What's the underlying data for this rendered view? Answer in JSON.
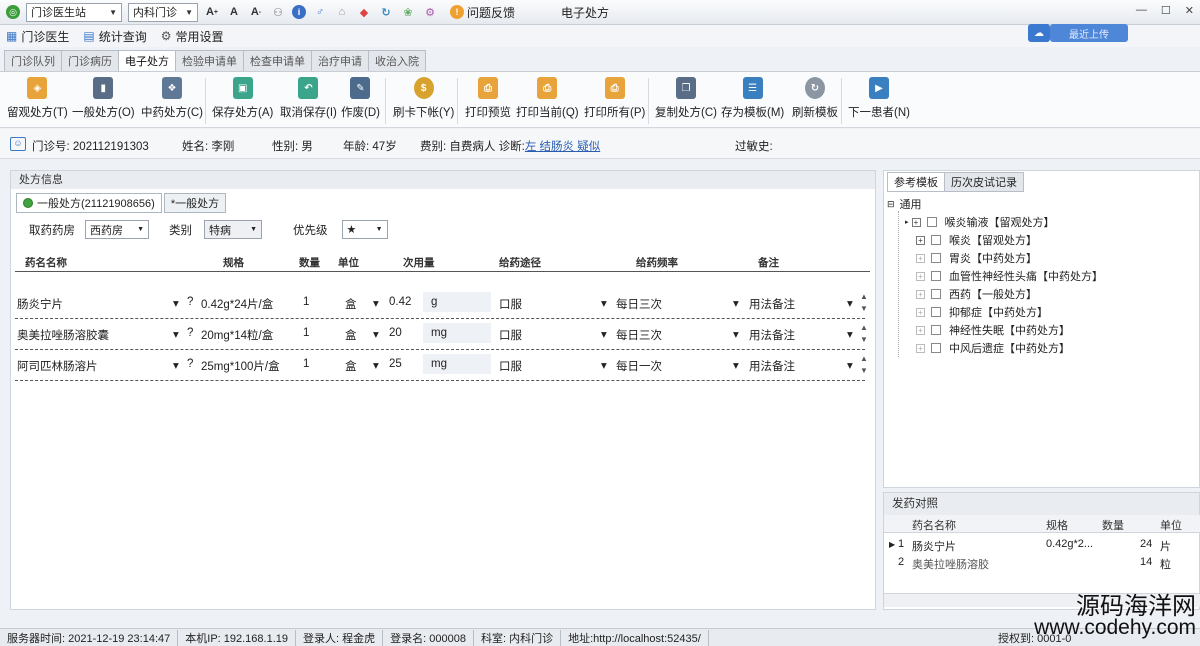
{
  "topbar": {
    "station": "门诊医生站",
    "dept": "内科门诊",
    "feedback": "问题反馈",
    "window_title": "电子处方"
  },
  "menu": {
    "items": [
      "门诊医生",
      "统计查询",
      "常用设置"
    ],
    "upload_label": "最近上传"
  },
  "tabs": [
    "门诊队列",
    "门诊病历",
    "电子处方",
    "检验申请单",
    "检查申请单",
    "治疗申请",
    "收治入院"
  ],
  "active_tab": "电子处方",
  "ribbon": {
    "buttons": [
      "留观处方(T)",
      "一般处方(O)",
      "中药处方(C)",
      "保存处方(A)",
      "取消保存(I)",
      "作废(D)",
      "刷卡下帐(Y)",
      "打印预览",
      "打印当前(Q)",
      "打印所有(P)",
      "复制处方(C)",
      "存为模板(M)",
      "刷新模板",
      "下一患者(N)"
    ]
  },
  "patient": {
    "id_label": "门诊号:",
    "id_value": "202112191303",
    "name_label": "姓名:",
    "name_value": "李刚",
    "gender_label": "性别:",
    "gender_value": "男",
    "age_label": "年龄:",
    "age_value": "47岁",
    "fee_label": "费别:",
    "fee_value": "自费病人",
    "diag_label": "诊断:",
    "diag_value": "左 结肠炎 疑似",
    "allergy_label": "过敏史:"
  },
  "rx": {
    "panel_title": "处方信息",
    "tab_active": "一般处方(21121908656)",
    "tab_other": "*一般处方",
    "pharmacy_label": "取药药房",
    "pharmacy_value": "西药房",
    "category_label": "类别",
    "category_value": "特病",
    "priority_label": "优先级",
    "priority_value": "★",
    "columns": [
      "药名名称",
      "规格",
      "数量",
      "单位",
      "次用量",
      "给药途径",
      "给药频率",
      "备注"
    ],
    "rows": [
      {
        "name": "肠炎宁片",
        "spec": "0.42g*24片/盒",
        "qty": "1",
        "unit": "盒",
        "dose": "0.42",
        "dose_unit": "g",
        "route": "口服",
        "freq": "每日三次",
        "note": "用法备注"
      },
      {
        "name": "奥美拉唑肠溶胶囊",
        "spec": "20mg*14粒/盒",
        "qty": "1",
        "unit": "盒",
        "dose": "20",
        "dose_unit": "mg",
        "route": "口服",
        "freq": "每日三次",
        "note": "用法备注"
      },
      {
        "name": "阿司匹林肠溶片",
        "spec": "25mg*100片/盒",
        "qty": "1",
        "unit": "盒",
        "dose": "25",
        "dose_unit": "mg",
        "route": "口服",
        "freq": "每日一次",
        "note": "用法备注"
      }
    ]
  },
  "ref": {
    "tabs": [
      "参考模板",
      "历次皮试记录"
    ],
    "root": "通用",
    "items": [
      "喉炎输液【留观处方】",
      "喉炎【留观处方】",
      "胃炎【中药处方】",
      "血管性神经性头痛【中药处方】",
      "西药【一般处方】",
      "抑郁症【中药处方】",
      "神经性失眠【中药处方】",
      "中风后遗症【中药处方】"
    ]
  },
  "dispense": {
    "title": "发药对照",
    "columns": [
      "药名名称",
      "规格",
      "数量",
      "单位"
    ],
    "rows": [
      {
        "idx": "1",
        "name": "肠炎宁片",
        "spec": "0.42g*2...",
        "qty": "24",
        "unit": "片"
      },
      {
        "idx": "2",
        "name": "奥美拉唑肠溶胶",
        "spec": "",
        "qty": "14",
        "unit": "粒"
      }
    ]
  },
  "status": {
    "server_time": "服务器时间: 2021-12-19 23:14:47",
    "ip": "本机IP: 192.168.1.19",
    "login_user": "登录人: 程金虎",
    "login_name": "登录名: 000008",
    "dept": "科室: 内科门诊",
    "address": "地址:http://localhost:52435/",
    "right": "授权到: 0001-0"
  },
  "watermark": {
    "line1": "源码海洋网",
    "line2": "www.codehy.com"
  }
}
